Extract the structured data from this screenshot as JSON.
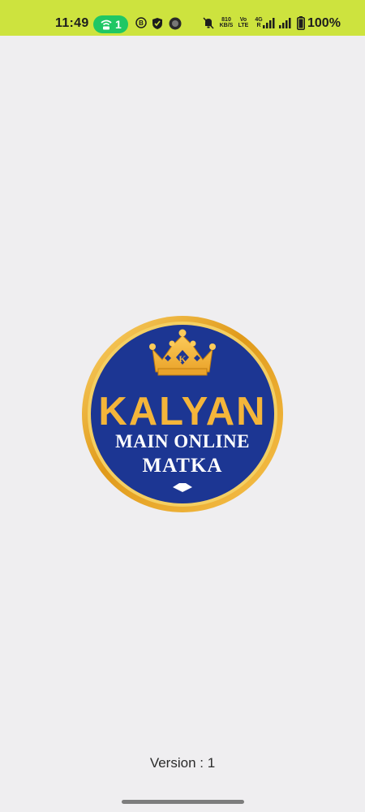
{
  "status_bar": {
    "time": "11:49",
    "hotspot_count": "1",
    "net_speed_value": "810",
    "net_speed_unit": "KB/S",
    "volte_top": "Vo",
    "volte_bottom": "LTE",
    "network_top": "4G",
    "network_bottom": "R",
    "battery": "100%",
    "bg_color": "#cde33e",
    "hotspot_color": "#1fc764",
    "icons": [
      "wifi-hotspot-icon",
      "b-icon",
      "shield-icon",
      "avatar-icon",
      "mute-icon",
      "signal-icon",
      "battery-icon"
    ]
  },
  "splash": {
    "logo_line1": "KALYAN",
    "logo_line2": "MAIN ONLINE",
    "logo_line3": "MATKA",
    "crown_letter": "K",
    "logo_colors": {
      "ring": "#e3a21b",
      "disc": "#1c3693",
      "accent": "#f4b53a",
      "text_white": "#ffffff"
    }
  },
  "footer": {
    "version": "Version : 1"
  }
}
